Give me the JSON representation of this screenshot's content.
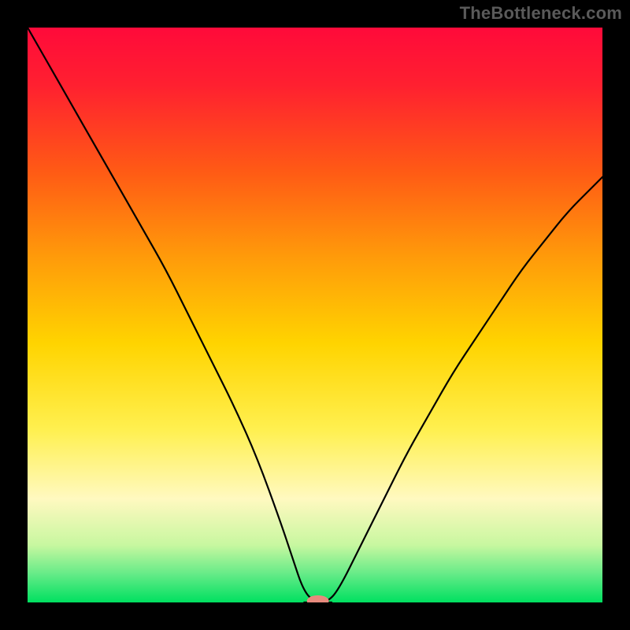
{
  "watermark": "TheBottleneck.com",
  "colors": {
    "frame": "#000000",
    "top": "#ff0a3a",
    "mid": "#ffe20a",
    "low": "#00e060",
    "curve": "#000000",
    "marker": "#e78a7d"
  },
  "chart_data": {
    "type": "line",
    "title": "",
    "xlabel": "",
    "ylabel": "",
    "xlim": [
      0,
      100
    ],
    "ylim": [
      0,
      100
    ],
    "grid": false,
    "legend": false,
    "annotations": [],
    "series": [
      {
        "name": "bottleneck-curve",
        "x": [
          0,
          4,
          8,
          12,
          16,
          20,
          24,
          28,
          32,
          36,
          40,
          44,
          46,
          48,
          50,
          52,
          54,
          58,
          62,
          66,
          70,
          74,
          78,
          82,
          86,
          90,
          94,
          98,
          100
        ],
        "values": [
          100,
          93,
          86,
          79,
          72,
          65,
          58,
          50,
          42,
          34,
          25,
          14,
          8,
          2,
          0,
          0,
          2,
          10,
          18,
          26,
          33,
          40,
          46,
          52,
          58,
          63,
          68,
          72,
          74
        ]
      }
    ],
    "flat_segment": {
      "x0": 48,
      "x1": 53,
      "y": 0
    },
    "marker": {
      "x": 50.5,
      "y": 0,
      "rx": 2.2,
      "ry": 1.1
    },
    "gradient_stops": [
      {
        "offset": 0.0,
        "color": "#ff0a3a"
      },
      {
        "offset": 0.1,
        "color": "#ff2030"
      },
      {
        "offset": 0.25,
        "color": "#ff5a15"
      },
      {
        "offset": 0.4,
        "color": "#ff9b0a"
      },
      {
        "offset": 0.55,
        "color": "#ffd400"
      },
      {
        "offset": 0.7,
        "color": "#fff050"
      },
      {
        "offset": 0.82,
        "color": "#fff9c0"
      },
      {
        "offset": 0.9,
        "color": "#c8f7a0"
      },
      {
        "offset": 0.95,
        "color": "#66eb88"
      },
      {
        "offset": 1.0,
        "color": "#00e060"
      }
    ]
  }
}
